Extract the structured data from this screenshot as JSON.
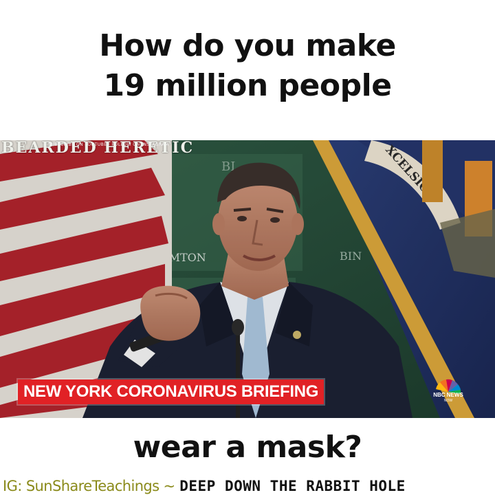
{
  "caption": {
    "top_line1": "How do you make",
    "top_line2": "19 million people",
    "bottom": "wear a mask?"
  },
  "video": {
    "watermark": "BEARDED HERETIC",
    "watermark_sub": "SUBSCRIBE ON YOUTUBE · FOLLOW ON INSTAGRAM",
    "lower_third": "NEW YORK CORONAVIRUS BRIEFING",
    "lower_third_color": "#e12125",
    "network_logo": "NBC NEWS",
    "network_sub": "NOW",
    "backdrop_text_1": "BI",
    "backdrop_text_2": "AMTON",
    "backdrop_text_3": "BIN",
    "flag_text": "XCELSIOR"
  },
  "credit": {
    "handle": "IG: SunShareTeachings ~",
    "tag": "DEEP DOWN THE RABBIT HOLE"
  },
  "colors": {
    "caption_text": "#111111",
    "handle_text": "#8a8a1a",
    "background": "#ffffff"
  }
}
